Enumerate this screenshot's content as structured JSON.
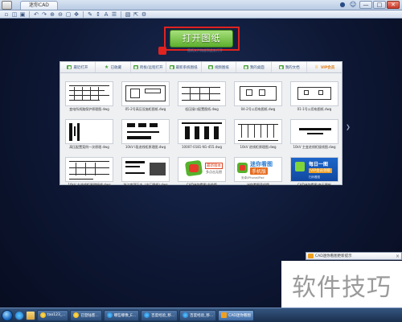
{
  "window": {
    "title": "迷你CAD"
  },
  "title_bar_icons": [
    "lock-icon",
    "user-icon",
    "minimize-icon",
    "maximize-icon",
    "close-icon"
  ],
  "toolbar": {
    "icons": [
      "new-icon",
      "open-icon",
      "save-icon",
      "print-icon",
      "undo-icon",
      "redo-icon",
      "zoom-in-icon",
      "zoom-out-icon",
      "zoom-window-icon",
      "pan-icon",
      "pen-icon",
      "measure-icon",
      "text-icon",
      "layer-icon",
      "folder-icon",
      "export-icon",
      "settings-icon"
    ]
  },
  "open_button": {
    "label": "打开图纸",
    "hint": "图纸文件拖放到此处打开"
  },
  "tabs": [
    {
      "label": "最近打开",
      "icon": "recent-icon"
    },
    {
      "label": "已收藏",
      "icon": "star-icon"
    },
    {
      "label": "跨板/远程打开",
      "icon": "remote-icon"
    },
    {
      "label": "最新系统图纸",
      "icon": "system-icon"
    },
    {
      "label": "视频图纸",
      "icon": "video-icon"
    },
    {
      "label": "我的桌面",
      "icon": "desktop-icon"
    },
    {
      "label": "我的文档",
      "icon": "documents-icon"
    },
    {
      "label": "VIP会员",
      "icon": "vip-icon"
    }
  ],
  "files": [
    {
      "name": "变电所线路保护原理图.dwg",
      "kind": "drawing"
    },
    {
      "name": "05-2号高压设施柜图纸.dwg",
      "kind": "drawing"
    },
    {
      "name": "低压接口配置图纸.dwg",
      "kind": "drawing"
    },
    {
      "name": "04-2号公用电图纸.dwg",
      "kind": "drawing"
    },
    {
      "name": "01-1号公用电图纸.dwg",
      "kind": "drawing"
    },
    {
      "name": "高压配置案例一次原理.dwg",
      "kind": "drawing"
    },
    {
      "name": "10kV I段进线柜原理图.dwg",
      "kind": "drawing"
    },
    {
      "name": "10007-0181-N1-455.dwg",
      "kind": "drawing"
    },
    {
      "name": "10kV 进线柜原理图.dwg",
      "kind": "drawing"
    },
    {
      "name": "10kV 主变进线柜接线图.dwg",
      "kind": "drawing"
    },
    {
      "name": "10kV 主进线柜原理接线.dwg",
      "kind": "drawing"
    },
    {
      "name": "浙江宇顶万丰（出厂图纸).dwg",
      "kind": "drawing"
    },
    {
      "name": "CAD迷你看图 升级版",
      "kind": "ad-cad",
      "tag": "最新版本",
      "text": "多点击无偿"
    },
    {
      "name": "迷你看图手机版",
      "kind": "ad-mob",
      "t1": "迷你看图",
      "t2": "手机版",
      "t3": "安卓/iPhone/iPad"
    },
    {
      "name": "CAD迷你看图 每天更新",
      "kind": "ad-day",
      "t1": "每日一图",
      "t2": "VIP会员领取",
      "t3": "扫码看图"
    }
  ],
  "notification": {
    "text": "CAD迷你看图更新提示"
  },
  "watermark": "软件技巧",
  "taskbar": {
    "items": [
      {
        "label": "tao123_...",
        "icon": "qq"
      },
      {
        "label": "已登陆客...",
        "icon": "qq"
      },
      {
        "label": "哪些哪像_E...",
        "icon": "ie"
      },
      {
        "label": "百度经验_移...",
        "icon": "ie"
      },
      {
        "label": "百度经验_移...",
        "icon": "ie"
      },
      {
        "label": "CAD迷你看图",
        "icon": "cad",
        "active": true
      }
    ]
  }
}
